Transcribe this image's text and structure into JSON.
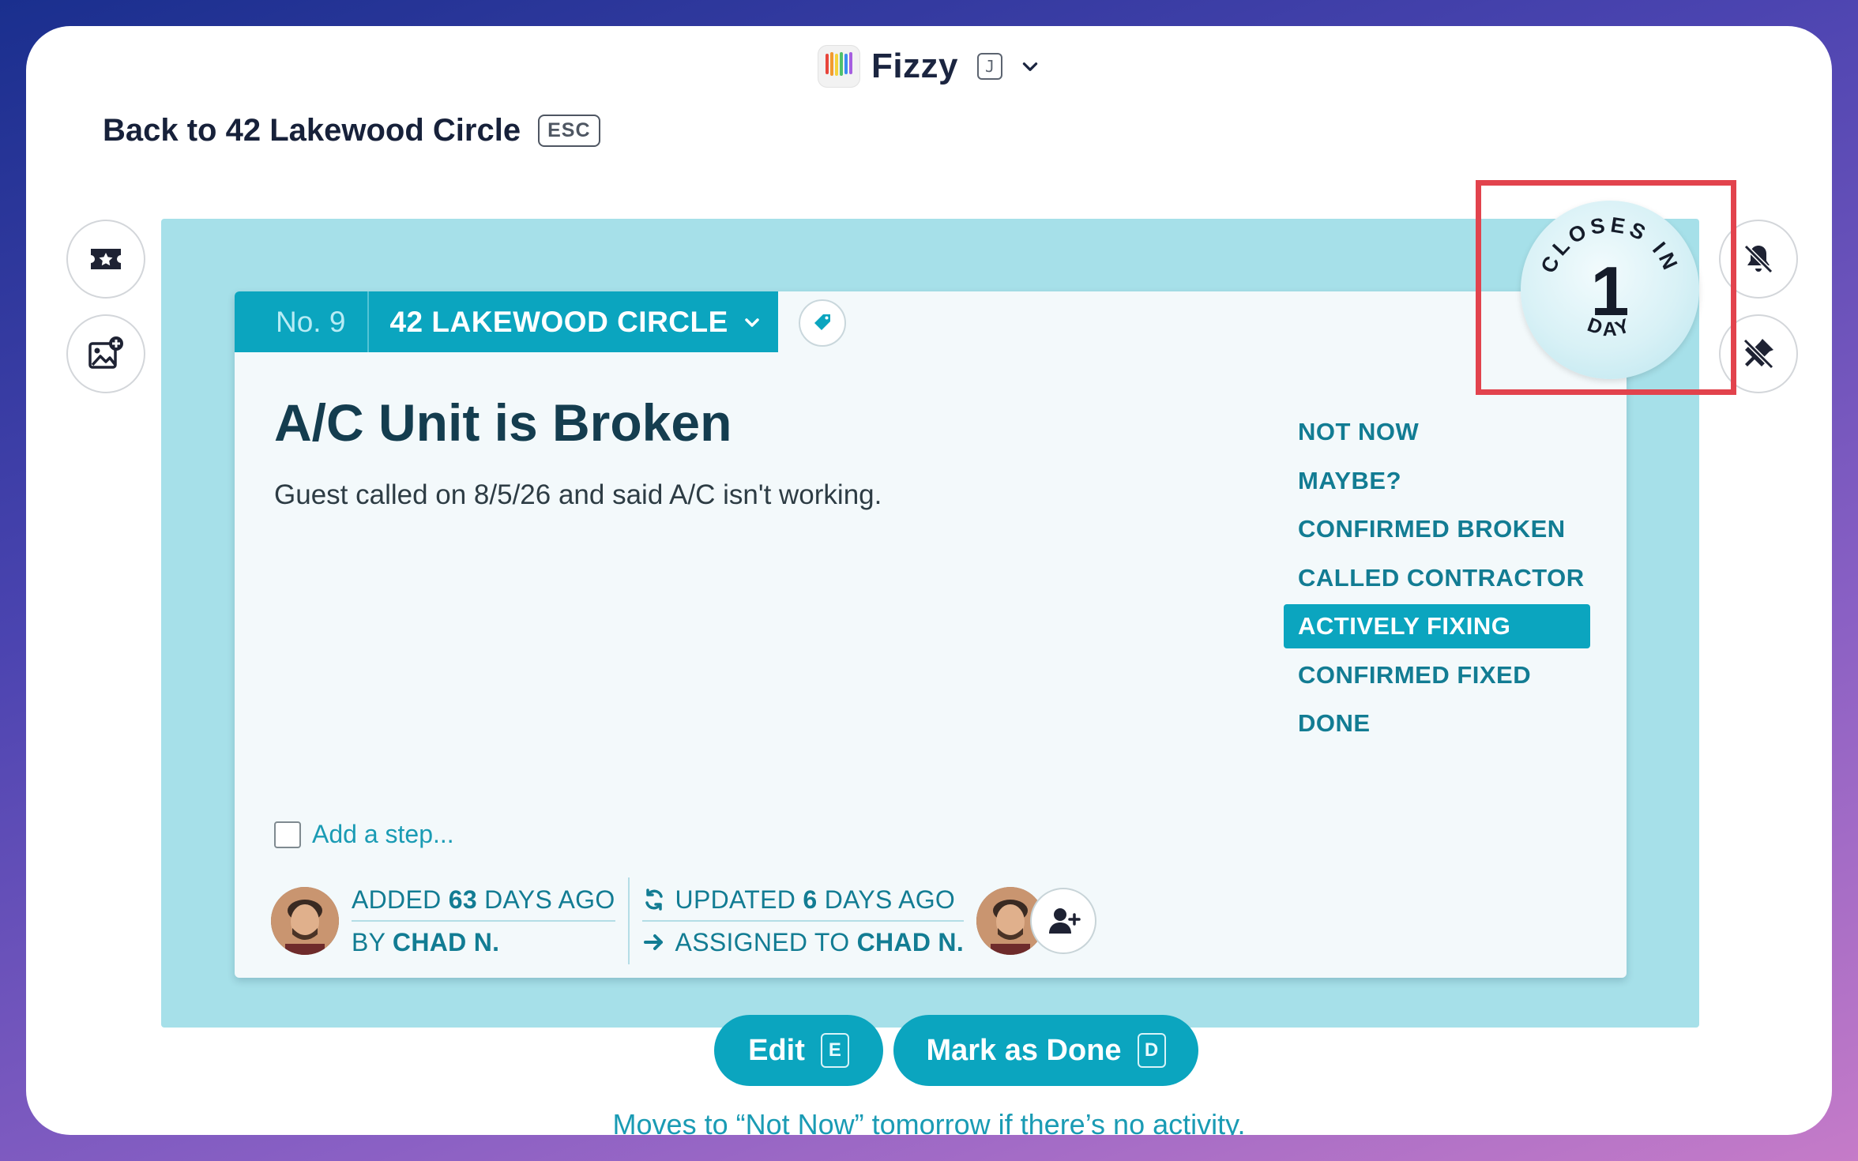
{
  "app": {
    "name": "Fizzy",
    "shortcut": "J"
  },
  "back": {
    "label": "Back to 42 Lakewood Circle",
    "shortcut": "ESC"
  },
  "card": {
    "number": "No. 9",
    "board": "42 LAKEWOOD CIRCLE",
    "title": "A/C Unit is Broken",
    "description": "Guest called on 8/5/26 and said A/C isn't working.",
    "stages": [
      {
        "label": "NOT NOW"
      },
      {
        "label": "MAYBE?"
      },
      {
        "label": "CONFIRMED BROKEN"
      },
      {
        "label": "CALLED CONTRACTOR"
      },
      {
        "label": "ACTIVELY FIXING",
        "active": true
      },
      {
        "label": "CONFIRMED FIXED"
      },
      {
        "label": "DONE"
      }
    ],
    "step_placeholder": "Add a step...",
    "meta": {
      "added_prefix": "ADDED",
      "added_days": "63",
      "added_suffix": "DAYS AGO",
      "by_prefix": "BY",
      "by_name": "CHAD N.",
      "updated_prefix": "UPDATED",
      "updated_days": "6",
      "updated_suffix": "DAYS AGO",
      "assigned_prefix": "ASSIGNED TO",
      "assigned_name": "CHAD N."
    }
  },
  "closes": {
    "top": "CLOSES IN",
    "number": "1",
    "bottom": "DAY"
  },
  "actions": {
    "edit_label": "Edit",
    "edit_shortcut": "E",
    "done_label": "Mark as Done",
    "done_shortcut": "D"
  },
  "footnote": "Moves to “Not Now” tomorrow if there’s no activity.",
  "colors": {
    "accent": "#0ba5bf",
    "board_bg": "#a6e0e9",
    "highlight": "#e2434d"
  }
}
